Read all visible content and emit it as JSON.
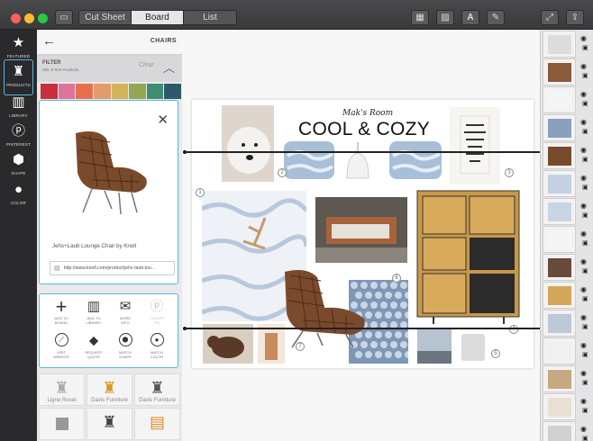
{
  "toolbar": {
    "tabs": [
      {
        "label": "Cut Sheet",
        "active": false
      },
      {
        "label": "Board",
        "active": true
      },
      {
        "label": "List",
        "active": false
      }
    ],
    "right_icons": [
      "grid-view-icon",
      "image-icon",
      "text-icon",
      "pen-icon",
      "expand-icon",
      "share-icon"
    ]
  },
  "rail": {
    "items": [
      {
        "label": "FEATURED",
        "icon": "star-icon",
        "glyph": "★"
      },
      {
        "label": "PRODUCTS",
        "icon": "chair-icon",
        "glyph": "♜",
        "active": true
      },
      {
        "label": "LIBRARY",
        "icon": "books-icon",
        "glyph": "▥"
      },
      {
        "label": "PINTEREST",
        "icon": "pinterest-icon",
        "glyph": "ⓟ"
      },
      {
        "label": "SHAPE",
        "icon": "cube-icon",
        "glyph": "⬢"
      },
      {
        "label": "COLOR",
        "icon": "drop-icon",
        "glyph": "●"
      }
    ]
  },
  "panel": {
    "title": "CHAIRS",
    "filter_label": "FILTER",
    "filter_count": "485 of 916 Products",
    "filter_clear": "Clear",
    "swatches": [
      "#c9303e",
      "#e0739b",
      "#e76f4e",
      "#e29c6b",
      "#d4b35a",
      "#93a653",
      "#3e8d72",
      "#2d5a6b"
    ],
    "product": {
      "name": "Jehs+Laub Lounge Chair by Knoll",
      "url": "http://www.knoll.com/product/jehs-laub-lou..."
    },
    "actions": [
      {
        "label": "ADD TO\nBOARD",
        "icon": "plus-icon",
        "glyph": "+"
      },
      {
        "label": "ADD TO\nLIBRARY",
        "icon": "books-icon",
        "glyph": "▥"
      },
      {
        "label": "MORE\nINFO",
        "icon": "mail-icon",
        "glyph": "✉"
      },
      {
        "label": "CREATE\nPIN",
        "icon": "pinterest-icon",
        "glyph": "ⓟ",
        "faded": true
      },
      {
        "label": "VISIT\nWEBSITE",
        "icon": "compass-icon",
        "glyph": "⊘"
      },
      {
        "label": "REQUEST\nQUOTE",
        "icon": "tag-icon",
        "glyph": "⬥"
      },
      {
        "label": "MATCH\nSHAPE",
        "icon": "cube-icon",
        "glyph": "⬢"
      },
      {
        "label": "MATCH\nCOLOR",
        "icon": "drop-icon",
        "glyph": "●"
      }
    ],
    "grid": [
      {
        "label": "Ligne Roset"
      },
      {
        "label": "Davis Furniture"
      },
      {
        "label": "Davis Furniture"
      }
    ]
  },
  "board": {
    "subtitle": "Mak's Room",
    "title": "COOL & COZY",
    "numbers": [
      "1",
      "2",
      "3",
      "4",
      "5",
      "6",
      "7"
    ]
  }
}
